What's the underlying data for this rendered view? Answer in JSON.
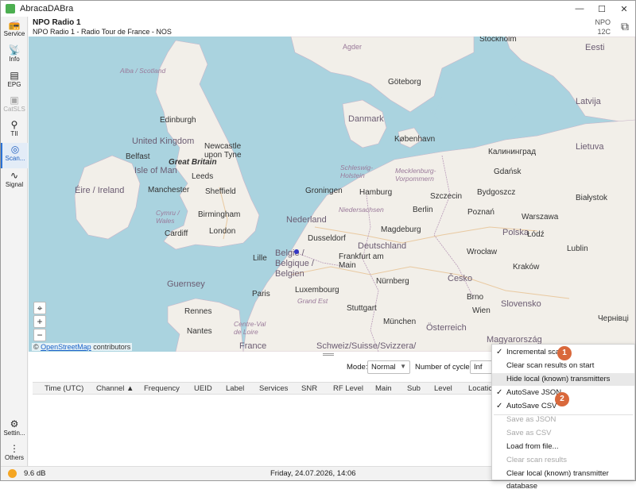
{
  "app": {
    "title": "AbracaDABra"
  },
  "window_controls": {
    "minimize": "—",
    "maximize": "☐",
    "close": "✕"
  },
  "sidebar": {
    "items": [
      {
        "label": "Service",
        "icon": "radio-icon"
      },
      {
        "label": "Info",
        "icon": "broadcast-icon"
      },
      {
        "label": "EPG",
        "icon": "epg-icon"
      },
      {
        "label": "CatSLS",
        "icon": "slideshow-icon"
      },
      {
        "label": "TII",
        "icon": "map-pin-icon"
      },
      {
        "label": "Scan...",
        "icon": "scan-icon"
      },
      {
        "label": "Signal",
        "icon": "signal-icon"
      }
    ],
    "bottom": [
      {
        "label": "Settin...",
        "icon": "gear-icon"
      },
      {
        "label": "Others",
        "icon": "more-icon"
      }
    ]
  },
  "header": {
    "station_name": "NPO Radio 1",
    "station_text": "NPO Radio 1 - Radio Tour de France - NOS",
    "ensemble": "NPO",
    "channel": "12C"
  },
  "map": {
    "labels": {
      "stockholm": "Stockholm",
      "agder": "Agder",
      "goteborg": "Göteborg",
      "eesti": "Eesti",
      "latvija": "Latvija",
      "alba": "Alba / Scotland",
      "edinburgh": "Edinburgh",
      "danmark": "Danmark",
      "kobenhavn": "København",
      "kaliningrad": "Калининград",
      "lietuva": "Lietuva",
      "united_kingdom": "United Kingdom",
      "belfast": "Belfast",
      "newcastle": "Newcastle upon Tyne",
      "isle_of_man": "Isle of Man",
      "great_britain": "Great Britain",
      "eire": "Éire / Ireland",
      "leeds": "Leeds",
      "manchester": "Manchester",
      "sheffield": "Sheffield",
      "cymru": "Cymru / Wales",
      "birmingham": "Birmingham",
      "cardiff": "Cardiff",
      "london": "London",
      "schleswig": "Schleswig-Holstein",
      "mecklenburg": "Mecklenburg-Vorpommern",
      "groningen": "Groningen",
      "hamburg": "Hamburg",
      "szczecin": "Szczecin",
      "bydgoszcz": "Bydgoszcz",
      "gdansk": "Gdańsk",
      "bialystok": "Białystok",
      "niedersachsen": "Niedersachsen",
      "nederland": "Nederland",
      "berlin": "Berlin",
      "poznan": "Poznań",
      "warszawa": "Warszawa",
      "polska": "Polska",
      "magdeburg": "Magdeburg",
      "dusseldorf": "Dusseldorf",
      "deutschland": "Deutschland",
      "lodz": "Łódź",
      "lublin": "Lublin",
      "lille": "Lille",
      "belgie": "België / Belgique / Belgien",
      "frankfurt": "Frankfurt am Main",
      "wroclaw": "Wrocław",
      "krakow": "Kraków",
      "guernsey": "Guernsey",
      "luxembourg": "Luxembourg",
      "nurnberg": "Nürnberg",
      "cesko": "Česko",
      "paris": "Paris",
      "grand_est": "Grand Est",
      "brno": "Brno",
      "slovensko": "Slovensko",
      "rennes": "Rennes",
      "stuttgart": "Stuttgart",
      "munchen": "München",
      "wien": "Wien",
      "nantes": "Nantes",
      "centre": "Centre-Val de Loire",
      "osterreich": "Österreich",
      "chernivtsi": "Чернівці",
      "france": "France",
      "schweiz": "Schweiz/Suisse/Svizzera/",
      "magyarorszag": "Magyarország"
    },
    "attribution_prefix": "©",
    "attribution_link": "OpenStreetMap",
    "attribution_suffix": "contributors",
    "controls": {
      "locate": "⌖",
      "zoom_in": "+",
      "zoom_out": "−"
    }
  },
  "scan": {
    "mode_label": "Mode:",
    "mode_value": "Normal",
    "cycles_label": "Number of cycles:",
    "cycles_value": "Inf",
    "columns": [
      "Time (UTC)",
      "Channel ▲",
      "Frequency",
      "UEID",
      "Label",
      "Services",
      "SNR",
      "RF Level",
      "Main",
      "Sub",
      "Level",
      "Location"
    ]
  },
  "context_menu": {
    "items": [
      {
        "label": "Incremental scan",
        "checked": true,
        "enabled": true
      },
      {
        "label": "Clear scan results on start",
        "checked": false,
        "enabled": true
      },
      {
        "label": "Hide local (known) transmitters",
        "checked": false,
        "enabled": true
      },
      {
        "label": "AutoSave JSON",
        "checked": true,
        "enabled": true
      },
      {
        "label": "AutoSave CSV",
        "checked": true,
        "enabled": true
      },
      {
        "label": "Save as JSON",
        "checked": false,
        "enabled": false
      },
      {
        "label": "Save as CSV",
        "checked": false,
        "enabled": false
      },
      {
        "label": "Load from file...",
        "checked": false,
        "enabled": true
      },
      {
        "label": "Clear scan results",
        "checked": false,
        "enabled": false
      },
      {
        "label": "Clear local (known) transmitter database",
        "checked": false,
        "enabled": true
      }
    ],
    "check_glyph": "✓"
  },
  "badges": {
    "one": "1",
    "two": "2"
  },
  "statusbar": {
    "snr": "9.6 dB",
    "datetime": "Friday, 24.07.2026, 14:06"
  },
  "colors": {
    "accent": "#2b72d6",
    "badge": "#d9683b",
    "signal": "#f5a623",
    "sea": "#aad3df",
    "land": "#f2efe9"
  }
}
